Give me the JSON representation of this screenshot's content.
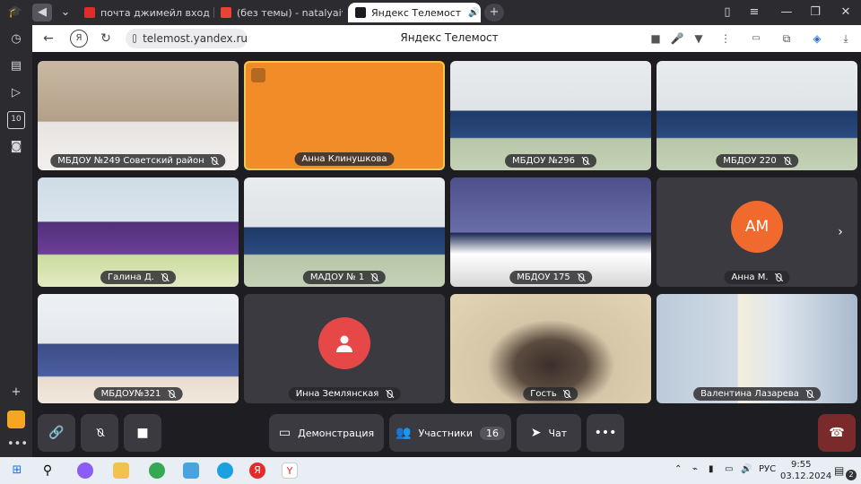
{
  "browser": {
    "tabs": [
      {
        "label": "почта джимейл вход gma",
        "favicon_color": "#e32b2b"
      },
      {
        "label": "(без темы) - natalyaivochk",
        "favicon_color": "#ea4335"
      },
      {
        "label": "Яндекс Телемост",
        "favicon_color": "#1b1b1f"
      }
    ],
    "new_tab_label": "+",
    "url": "telemost.yandex.ru",
    "page_title": "Яндекс Телемост"
  },
  "participants": [
    {
      "name": "МБДОУ №249 Советский район",
      "muted": true,
      "type": "video",
      "scene": "woman"
    },
    {
      "name": "Анна Клинушкова",
      "muted": false,
      "type": "color",
      "color": "#f28c28",
      "talking": true
    },
    {
      "name": "МБДОУ №296",
      "muted": true,
      "type": "video",
      "scene": "class"
    },
    {
      "name": "МБДОУ 220",
      "muted": true,
      "type": "video",
      "scene": "class"
    },
    {
      "name": "Галина Д.",
      "muted": true,
      "type": "video",
      "scene": "class2"
    },
    {
      "name": "МАДОУ № 1",
      "muted": true,
      "type": "video",
      "scene": "class"
    },
    {
      "name": "МБДОУ 175",
      "muted": true,
      "type": "video",
      "scene": "stage"
    },
    {
      "name": "Анна М.",
      "muted": true,
      "type": "avatar",
      "initials": "AM",
      "color": "#f06a2e"
    },
    {
      "name": "МБДОУ№321",
      "muted": true,
      "type": "video",
      "scene": "class3"
    },
    {
      "name": "Инна Землянская",
      "muted": true,
      "type": "avatar",
      "initials": "",
      "color": "#e64848"
    },
    {
      "name": "Гость",
      "muted": true,
      "type": "video",
      "scene": "guest"
    },
    {
      "name": "Валентина Лазарева",
      "muted": true,
      "type": "video",
      "scene": "office"
    }
  ],
  "toolbar": {
    "demo_label": "Демонстрация",
    "participants_label": "Участники",
    "participants_count": "16",
    "chat_label": "Чат"
  },
  "taskbar": {
    "lang": "РУС",
    "time": "9:55",
    "date": "03.12.2024",
    "notif_count": "2"
  }
}
